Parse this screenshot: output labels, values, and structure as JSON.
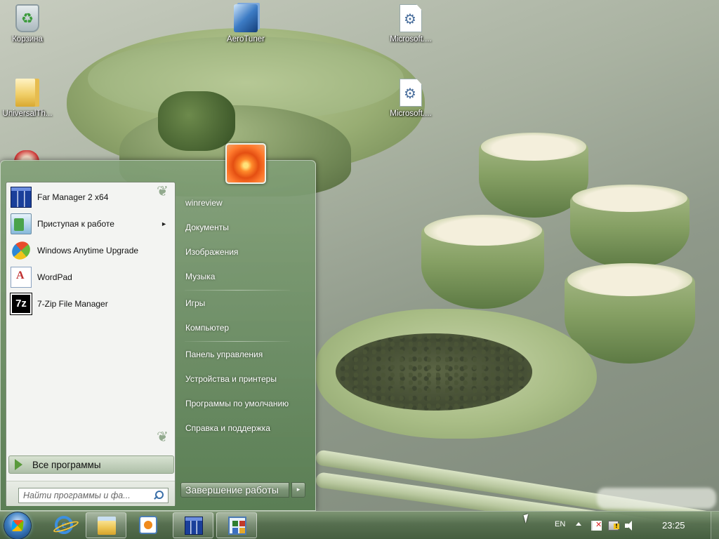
{
  "desktop": {
    "icons": [
      {
        "label": "Корзина",
        "icon": "recycle-bin-icon"
      },
      {
        "label": "AeroTuner",
        "icon": "aerotuner-icon"
      },
      {
        "label": "Microsoft....",
        "icon": "config-file-icon"
      },
      {
        "label": "UniversalTh...",
        "icon": "folder-icon"
      },
      {
        "label": "Microsoft....",
        "icon": "config-file-icon"
      }
    ]
  },
  "start_menu": {
    "programs": [
      {
        "label": "Far Manager 2 x64",
        "icon": "far-manager-icon",
        "has_submenu": false
      },
      {
        "label": "Приступая к работе",
        "icon": "getting-started-icon",
        "has_submenu": true
      },
      {
        "label": "Windows Anytime Upgrade",
        "icon": "windows-logo-icon",
        "has_submenu": false
      },
      {
        "label": "WordPad",
        "icon": "wordpad-icon",
        "has_submenu": false
      },
      {
        "label": "7-Zip File Manager",
        "icon": "7zip-icon",
        "has_submenu": false
      }
    ],
    "submenu_arrow": "►",
    "all_programs_label": "Все программы",
    "search_placeholder": "Найти программы и фа...",
    "right_items": [
      {
        "label": "winreview"
      },
      {
        "label": "Документы"
      },
      {
        "label": "Изображения"
      },
      {
        "label": "Музыка"
      },
      {
        "label": "Игры"
      },
      {
        "label": "Компьютер"
      },
      {
        "label": "Панель управления"
      },
      {
        "label": "Устройства и принтеры"
      },
      {
        "label": "Программы по умолчанию"
      },
      {
        "label": "Справка и поддержка"
      }
    ],
    "shutdown_label": "Завершение работы",
    "shutdown_arrow": "▸"
  },
  "taskbar": {
    "pinned": [
      {
        "name": "internet-explorer",
        "glyph": "e"
      },
      {
        "name": "windows-explorer"
      },
      {
        "name": "media-player"
      },
      {
        "name": "far-manager"
      },
      {
        "name": "control-panel"
      }
    ],
    "language": "EN",
    "clock": "23:25"
  }
}
